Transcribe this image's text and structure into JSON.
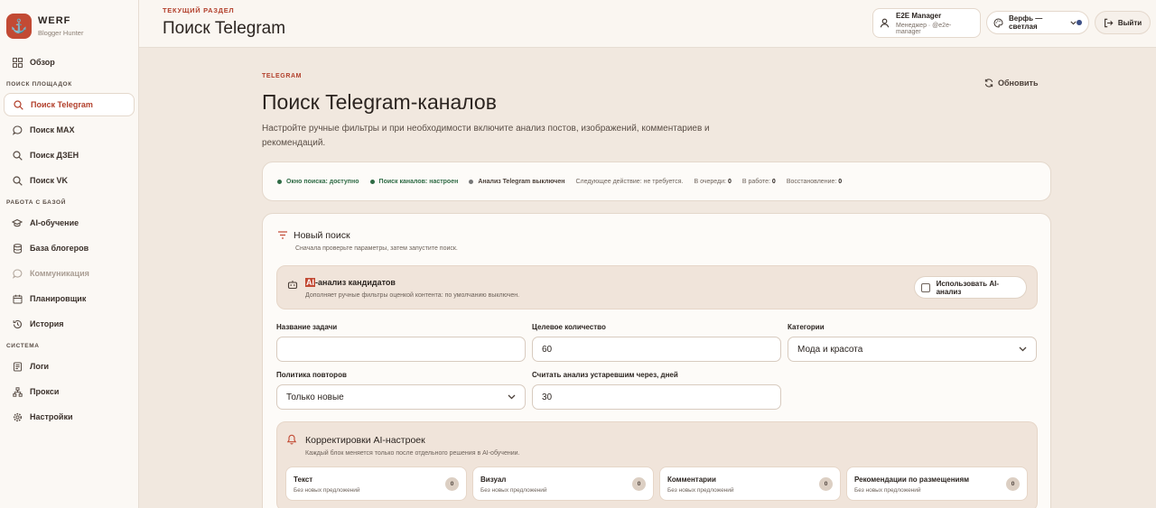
{
  "brand": {
    "name": "WERF",
    "subtitle": "Blogger Hunter",
    "logo_glyph": "⚓"
  },
  "sidebar": {
    "overview": "Обзор",
    "section_search": "ПОИСК ПЛОЩАДОК",
    "search_items": [
      "Поиск Telegram",
      "Поиск MAX",
      "Поиск ДЗЕН",
      "Поиск VK"
    ],
    "section_base": "РАБОТА С БАЗОЙ",
    "base_items": [
      "AI-обучение",
      "База блогеров",
      "Коммуникация",
      "Планировщик",
      "История"
    ],
    "section_system": "СИСТЕМА",
    "system_items": [
      "Логи",
      "Прокси",
      "Настройки"
    ]
  },
  "topbar": {
    "kicker": "ТЕКУЩИЙ РАЗДЕЛ",
    "title": "Поиск Telegram",
    "user_name": "E2E Manager",
    "user_role": "Менеджер · @e2e-manager",
    "theme": "Верфь — светлая",
    "logout": "Выйти"
  },
  "page": {
    "kicker": "TELEGRAM",
    "refresh": "Обновить",
    "title": "Поиск Telegram-каналов",
    "description": "Настройте ручные фильтры и при необходимости включите анализ постов, изображений, комментариев и рекомендаций."
  },
  "status": {
    "window": "Окно поиска: доступно",
    "channels": "Поиск каналов: настроен",
    "analysis": "Анализ Telegram выключен",
    "next_action": "Следующее действие: не требуется.",
    "queue_label": "В очереди:",
    "queue_value": "0",
    "work_label": "В работе:",
    "work_value": "0",
    "restore_label": "Восстановление:",
    "restore_value": "0"
  },
  "new_search": {
    "title": "Новый поиск",
    "subtitle": "Сначала проверьте параметры, затем запустите поиск.",
    "ai_title_hl": "AI",
    "ai_title_rest": "-анализ кандидатов",
    "ai_subtitle": "Дополняет ручные фильтры оценкой контента: по умолчанию выключен.",
    "ai_toggle": "Использовать AI-анализ",
    "task_name_label": "Название задачи",
    "task_name_value": "",
    "target_label": "Целевое количество",
    "target_value": "60",
    "category_label": "Категории",
    "category_value": "Мода и красота",
    "policy_label": "Политика повторов",
    "policy_value": "Только новые",
    "stale_label": "Считать анализ устаревшим через, дней",
    "stale_value": "30"
  },
  "corrections": {
    "title": "Корректировки AI-настроек",
    "subtitle": "Каждый блок меняется только после отдельного решения в AI-обучении.",
    "chips": [
      {
        "title": "Текст",
        "sub": "Без новых предложений",
        "count": "0"
      },
      {
        "title": "Визуал",
        "sub": "Без новых предложений",
        "count": "0"
      },
      {
        "title": "Комментарии",
        "sub": "Без новых предложений",
        "count": "0"
      },
      {
        "title": "Рекомендации по размещениям",
        "sub": "Без новых предложений",
        "count": "0"
      }
    ]
  }
}
